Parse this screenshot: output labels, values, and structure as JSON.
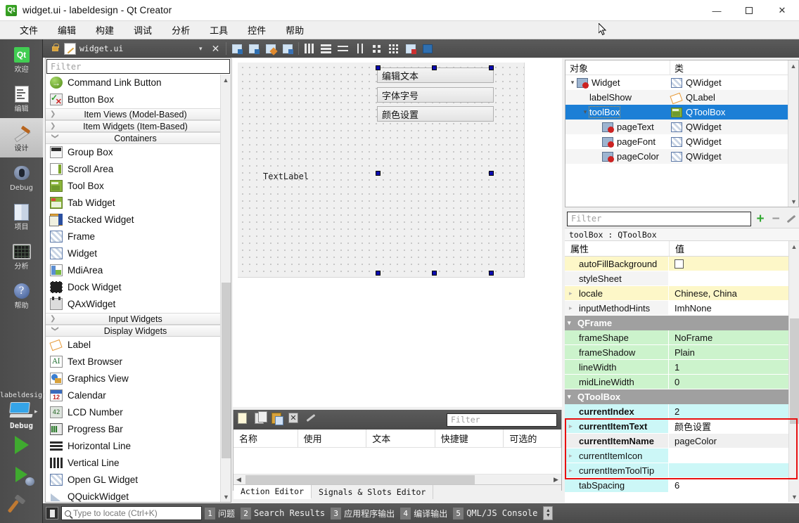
{
  "window": {
    "title": "widget.ui - labeldesign - Qt Creator",
    "app_icon": "qt-logo-icon",
    "minimize": "—",
    "maximize": "□",
    "close": "✕"
  },
  "menubar": {
    "items": [
      {
        "label": "文件",
        "name": "menu-file"
      },
      {
        "label": "编辑",
        "name": "menu-edit"
      },
      {
        "label": "构建",
        "name": "menu-build"
      },
      {
        "label": "调试",
        "name": "menu-debug"
      },
      {
        "label": "分析",
        "name": "menu-analyze"
      },
      {
        "label": "工具",
        "name": "menu-tools"
      },
      {
        "label": "控件",
        "name": "menu-widgets"
      },
      {
        "label": "帮助",
        "name": "menu-help"
      }
    ]
  },
  "toolbar": {
    "lock_icon": "lock-icon",
    "file_icon": "edit-file-icon",
    "filename": "widget.ui",
    "dropdown_caret": "▾",
    "close_label": "✕",
    "icons": [
      "edit-widgets-icon",
      "edit-signals-slots-icon",
      "edit-buddies-icon",
      "edit-tab-order-icon",
      "layout-horizontal-icon",
      "layout-vertical-icon",
      "layout-splitter-h-icon",
      "layout-splitter-v-icon",
      "layout-form-icon",
      "layout-grid-icon",
      "break-layout-icon",
      "adjust-size-icon"
    ]
  },
  "modebar": {
    "items": [
      {
        "label": "欢迎",
        "name": "mode-welcome",
        "icon": "qt-logo-icon"
      },
      {
        "label": "编辑",
        "name": "mode-edit",
        "icon": "document-icon"
      },
      {
        "label": "设计",
        "name": "mode-design",
        "icon": "design-brush-icon",
        "active": true
      },
      {
        "label": "Debug",
        "name": "mode-debug",
        "icon": "bug-icon"
      },
      {
        "label": "项目",
        "name": "mode-projects",
        "icon": "projects-icon"
      },
      {
        "label": "分析",
        "name": "mode-analyze",
        "icon": "analyze-icon"
      },
      {
        "label": "帮助",
        "name": "mode-help",
        "icon": "help-icon"
      }
    ],
    "kit_name": "labeldesign",
    "kit_config": "Debug",
    "run_button": "run-icon",
    "debug_button": "start-debug-icon",
    "build_button": "build-hammer-icon"
  },
  "widgetbox": {
    "filter_placeholder": "Filter",
    "rows": [
      {
        "type": "item",
        "label": "Command Link Button",
        "icon": "command-link-button-icon",
        "cls": "ic-cmdlink"
      },
      {
        "type": "item",
        "label": "Button Box",
        "icon": "button-box-icon",
        "cls": "ic-buttonbox"
      },
      {
        "type": "category",
        "label": "Item Views (Model-Based)",
        "expanded": false
      },
      {
        "type": "category",
        "label": "Item Widgets (Item-Based)",
        "expanded": false
      },
      {
        "type": "category",
        "label": "Containers",
        "expanded": true
      },
      {
        "type": "item",
        "label": "Group Box",
        "icon": "group-box-icon",
        "cls": "ic-groupbox"
      },
      {
        "type": "item",
        "label": "Scroll Area",
        "icon": "scroll-area-icon",
        "cls": "ic-scroll"
      },
      {
        "type": "item",
        "label": "Tool Box",
        "icon": "tool-box-icon",
        "cls": "ic-toolbox"
      },
      {
        "type": "item",
        "label": "Tab Widget",
        "icon": "tab-widget-icon",
        "cls": "ic-tabw"
      },
      {
        "type": "item",
        "label": "Stacked Widget",
        "icon": "stacked-widget-icon",
        "cls": "ic-stack"
      },
      {
        "type": "item",
        "label": "Frame",
        "icon": "frame-icon",
        "cls": "ic-hatch"
      },
      {
        "type": "item",
        "label": "Widget",
        "icon": "widget-icon",
        "cls": "ic-hatch"
      },
      {
        "type": "item",
        "label": "MdiArea",
        "icon": "mdi-area-icon",
        "cls": "ic-mdi"
      },
      {
        "type": "item",
        "label": "Dock Widget",
        "icon": "dock-widget-icon",
        "cls": "ic-dock"
      },
      {
        "type": "item",
        "label": "QAxWidget",
        "icon": "qax-widget-icon",
        "cls": "ic-qax"
      },
      {
        "type": "category",
        "label": "Input Widgets",
        "expanded": false
      },
      {
        "type": "category",
        "label": "Display Widgets",
        "expanded": true
      },
      {
        "type": "item",
        "label": "Label",
        "icon": "label-icon",
        "cls": "ic-label"
      },
      {
        "type": "item",
        "label": "Text Browser",
        "icon": "text-browser-icon",
        "cls": "ic-textbrowser"
      },
      {
        "type": "item",
        "label": "Graphics View",
        "icon": "graphics-view-icon",
        "cls": "ic-gview"
      },
      {
        "type": "item",
        "label": "Calendar",
        "icon": "calendar-icon",
        "cls": "ic-cal"
      },
      {
        "type": "item",
        "label": "LCD Number",
        "icon": "lcd-number-icon",
        "cls": "ic-lcd"
      },
      {
        "type": "item",
        "label": "Progress Bar",
        "icon": "progress-bar-icon",
        "cls": "ic-progress"
      },
      {
        "type": "item",
        "label": "Horizontal Line",
        "icon": "horizontal-line-icon",
        "cls": "ic-hline"
      },
      {
        "type": "item",
        "label": "Vertical Line",
        "icon": "vertical-line-icon",
        "cls": "ic-vline"
      },
      {
        "type": "item",
        "label": "Open GL Widget",
        "icon": "opengl-widget-icon",
        "cls": "ic-hatch"
      },
      {
        "type": "item",
        "label": "QQuickWidget",
        "icon": "qquick-widget-icon",
        "cls": "ic-quick"
      }
    ]
  },
  "form": {
    "toolbox_pages": [
      {
        "label": "编辑文本",
        "name": "pageText"
      },
      {
        "label": "字体字号",
        "name": "pageFont"
      },
      {
        "label": "颜色设置",
        "name": "pageColor"
      }
    ],
    "label_text": "TextLabel"
  },
  "action_panel": {
    "toolbar_icons": [
      "new-action-icon",
      "copy-action-icon",
      "paste-action-icon",
      "delete-action-icon",
      "configure-icon"
    ],
    "filter_placeholder": "Filter",
    "columns": [
      "名称",
      "使用",
      "文本",
      "快捷键",
      "可选的"
    ],
    "tabs": [
      {
        "label": "Action Editor",
        "active": true
      },
      {
        "label": "Signals & Slots Editor",
        "active": false
      }
    ]
  },
  "objecttree": {
    "columns": [
      "对象",
      "类"
    ],
    "rows": [
      {
        "name": "Widget",
        "class": "QWidget",
        "depth": 0,
        "expandable": true,
        "expanded": true,
        "icon": "form-icon",
        "class_icon": "widget-hatch-icon",
        "selected": false
      },
      {
        "name": "labelShow",
        "class": "QLabel",
        "depth": 1,
        "expandable": false,
        "icon": "none",
        "class_icon": "label-icon",
        "selected": false
      },
      {
        "name": "toolBox",
        "class": "QToolBox",
        "depth": 1,
        "expandable": true,
        "expanded": true,
        "icon": "none",
        "class_icon": "toolbox-icon",
        "selected": true
      },
      {
        "name": "pageText",
        "class": "QWidget",
        "depth": 2,
        "expandable": false,
        "icon": "form-icon",
        "class_icon": "widget-hatch-icon",
        "selected": false
      },
      {
        "name": "pageFont",
        "class": "QWidget",
        "depth": 2,
        "expandable": false,
        "icon": "form-icon",
        "class_icon": "widget-hatch-icon",
        "selected": false
      },
      {
        "name": "pageColor",
        "class": "QWidget",
        "depth": 2,
        "expandable": false,
        "icon": "form-icon",
        "class_icon": "widget-hatch-icon",
        "selected": false
      }
    ]
  },
  "propeditor": {
    "filter_placeholder": "Filter",
    "add_button": "add-icon",
    "remove_button": "remove-icon",
    "configure_button": "configure-icon",
    "object_line": "toolBox : QToolBox",
    "columns": [
      "属性",
      "值"
    ],
    "rows": [
      {
        "kind": "prop",
        "name": "autoFillBackground",
        "value": "",
        "value_type": "checkbox",
        "checked": false,
        "expandable": false,
        "band": "yellow"
      },
      {
        "kind": "prop",
        "name": "styleSheet",
        "value": "",
        "expandable": false,
        "band": "yellow-alt"
      },
      {
        "kind": "prop",
        "name": "locale",
        "value": "Chinese, China",
        "expandable": true,
        "band": "yellow"
      },
      {
        "kind": "prop",
        "name": "inputMethodHints",
        "value": "ImhNone",
        "expandable": true,
        "band": "yellow-alt"
      },
      {
        "kind": "group",
        "name": "QFrame"
      },
      {
        "kind": "prop",
        "name": "frameShape",
        "value": "NoFrame",
        "expandable": false,
        "band": "green"
      },
      {
        "kind": "prop",
        "name": "frameShadow",
        "value": "Plain",
        "expandable": false,
        "band": "green-alt"
      },
      {
        "kind": "prop",
        "name": "lineWidth",
        "value": "1",
        "expandable": false,
        "band": "green"
      },
      {
        "kind": "prop",
        "name": "midLineWidth",
        "value": "0",
        "expandable": false,
        "band": "green-alt"
      },
      {
        "kind": "group",
        "name": "QToolBox"
      },
      {
        "kind": "prop",
        "name": "currentIndex",
        "value": "2",
        "expandable": false,
        "band": "cyan",
        "bold": true
      },
      {
        "kind": "prop",
        "name": "currentItemText",
        "value": "颜色设置",
        "expandable": true,
        "band": "cyan-alt",
        "bold": true
      },
      {
        "kind": "prop",
        "name": "currentItemName",
        "value": "pageColor",
        "expandable": false,
        "band": "cyan-grey",
        "bold": true
      },
      {
        "kind": "prop",
        "name": "currentItemIcon",
        "value": "",
        "expandable": true,
        "band": "cyan-alt"
      },
      {
        "kind": "prop",
        "name": "currentItemToolTip",
        "value": "",
        "expandable": true,
        "band": "cyan"
      },
      {
        "kind": "prop",
        "name": "tabSpacing",
        "value": "6",
        "expandable": false,
        "band": "cyan-alt"
      }
    ],
    "highlight_color": "#e81010"
  },
  "statusbar": {
    "locate_placeholder": "Type to locate (Ctrl+K)",
    "search_icon": "search-icon",
    "panels": [
      {
        "num": "1",
        "label": "问题"
      },
      {
        "num": "2",
        "label": "Search Results"
      },
      {
        "num": "3",
        "label": "应用程序输出"
      },
      {
        "num": "4",
        "label": "编译输出"
      },
      {
        "num": "5",
        "label": "QML/JS Console"
      }
    ]
  }
}
